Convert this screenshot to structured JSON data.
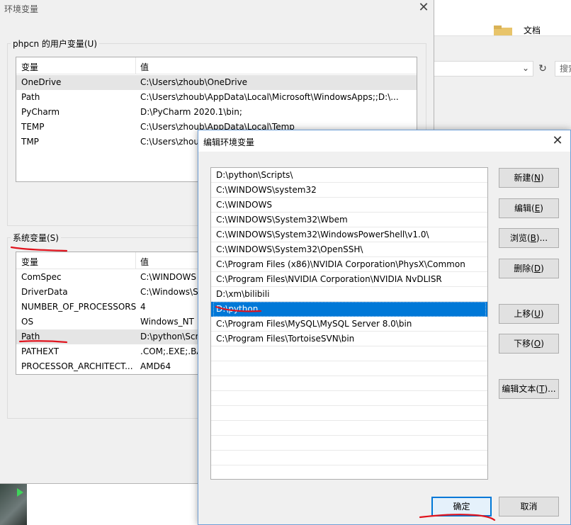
{
  "explorer": {
    "folder_label": "文档",
    "search_placeholder": "搜索"
  },
  "env_dialog": {
    "title": "环境变量",
    "user_group_label": "phpcn 的用户变量(U)",
    "user_vars": {
      "col_var": "变量",
      "col_val": "值",
      "rows": [
        {
          "name": "OneDrive",
          "value": "C:\\Users\\zhoub\\OneDrive"
        },
        {
          "name": "Path",
          "value": "C:\\Users\\zhoub\\AppData\\Local\\Microsoft\\WindowsApps;;D:\\..."
        },
        {
          "name": "PyCharm",
          "value": "D:\\PyCharm 2020.1\\bin;"
        },
        {
          "name": "TEMP",
          "value": "C:\\Users\\zhoub\\AppData\\Local\\Temp"
        },
        {
          "name": "TMP",
          "value": "C:\\Users\\zhou"
        }
      ]
    },
    "system_group_label": "系统变量(S)",
    "system_vars": {
      "col_var": "变量",
      "col_val": "值",
      "rows": [
        {
          "name": "ComSpec",
          "value": "C:\\WINDOWS"
        },
        {
          "name": "DriverData",
          "value": "C:\\Windows\\S"
        },
        {
          "name": "NUMBER_OF_PROCESSORS",
          "value": "4"
        },
        {
          "name": "OS",
          "value": "Windows_NT"
        },
        {
          "name": "Path",
          "value": "D:\\python\\Scr"
        },
        {
          "name": "PATHEXT",
          "value": ".COM;.EXE;.BA"
        },
        {
          "name": "PROCESSOR_ARCHITECT...",
          "value": "AMD64"
        }
      ]
    }
  },
  "edit_dialog": {
    "title": "编辑环境变量",
    "paths": [
      "D:\\python\\Scripts\\",
      "C:\\WINDOWS\\system32",
      "C:\\WINDOWS",
      "C:\\WINDOWS\\System32\\Wbem",
      "C:\\WINDOWS\\System32\\WindowsPowerShell\\v1.0\\",
      "C:\\WINDOWS\\System32\\OpenSSH\\",
      "C:\\Program Files (x86)\\NVIDIA Corporation\\PhysX\\Common",
      "C:\\Program Files\\NVIDIA Corporation\\NVIDIA NvDLISR",
      "D:\\xm\\bilibili",
      "D:\\python",
      "C:\\Program Files\\MySQL\\MySQL Server 8.0\\bin",
      "C:\\Program Files\\TortoiseSVN\\bin"
    ],
    "selected_path": "D:\\python",
    "buttons": {
      "new": {
        "label": "新建(",
        "key": "N",
        "end": ")"
      },
      "edit": {
        "label": "编辑(",
        "key": "E",
        "end": ")"
      },
      "browse": {
        "label": "浏览(",
        "key": "B",
        "end": ")..."
      },
      "delete": {
        "label": "删除(",
        "key": "D",
        "end": ")"
      },
      "move_up": {
        "label": "上移(",
        "key": "U",
        "end": ")"
      },
      "move_down": {
        "label": "下移(",
        "key": "O",
        "end": ")"
      },
      "edit_text": {
        "label": "编辑文本(",
        "key": "T",
        "end": ")..."
      },
      "ok": "确定",
      "cancel": "取消"
    }
  },
  "colors": {
    "selection": "#0078d7",
    "annotation_red": "#e0141e"
  }
}
